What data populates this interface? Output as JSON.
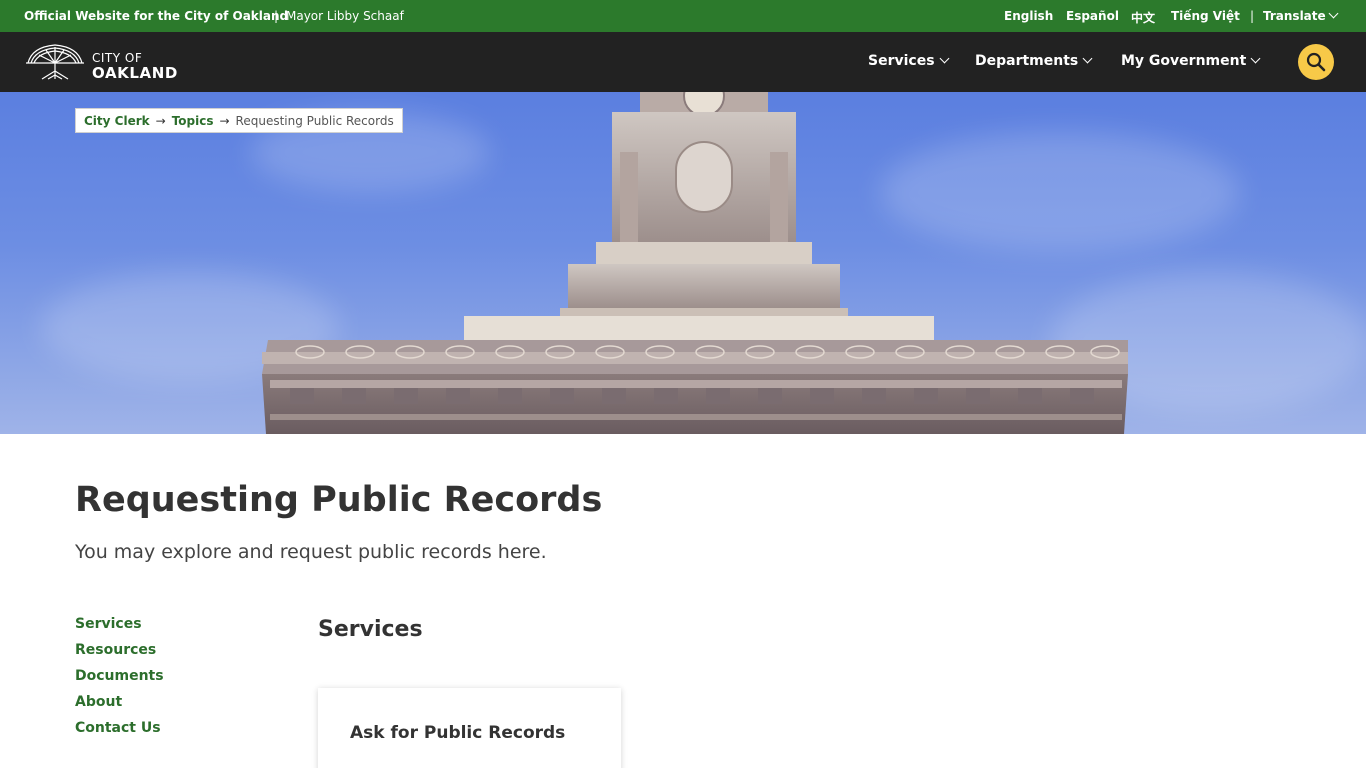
{
  "topbar": {
    "official": "Official Website for the City of Oakland",
    "separator": "|",
    "mayor": "Mayor Libby Schaaf",
    "languages": [
      "English",
      "Español",
      "中文",
      "Tiếng Việt"
    ],
    "translate": "Translate"
  },
  "nav": {
    "logo_line1": "CITY OF",
    "logo_line2": "OAKLAND",
    "items": [
      "Services",
      "Departments",
      "My Government"
    ]
  },
  "breadcrumb": {
    "items": [
      "City Clerk",
      "Topics"
    ],
    "arrow": "→",
    "current": "Requesting Public Records"
  },
  "page": {
    "title": "Requesting Public Records",
    "subtitle": "You may explore and request public records here."
  },
  "sidenav": {
    "items": [
      "Services",
      "Resources",
      "Documents",
      "About",
      "Contact Us"
    ]
  },
  "services": {
    "heading": "Services",
    "cards": [
      "Ask for Public Records"
    ]
  },
  "colors": {
    "topbar_green": "#2c7a2c",
    "nav_dark": "#222222",
    "link_green": "#2c6e2c",
    "search_yellow": "#f7c948"
  },
  "icons": {
    "search": "search-icon",
    "logo": "oak-tree-logo",
    "dropdown": "chevron-down-icon"
  }
}
